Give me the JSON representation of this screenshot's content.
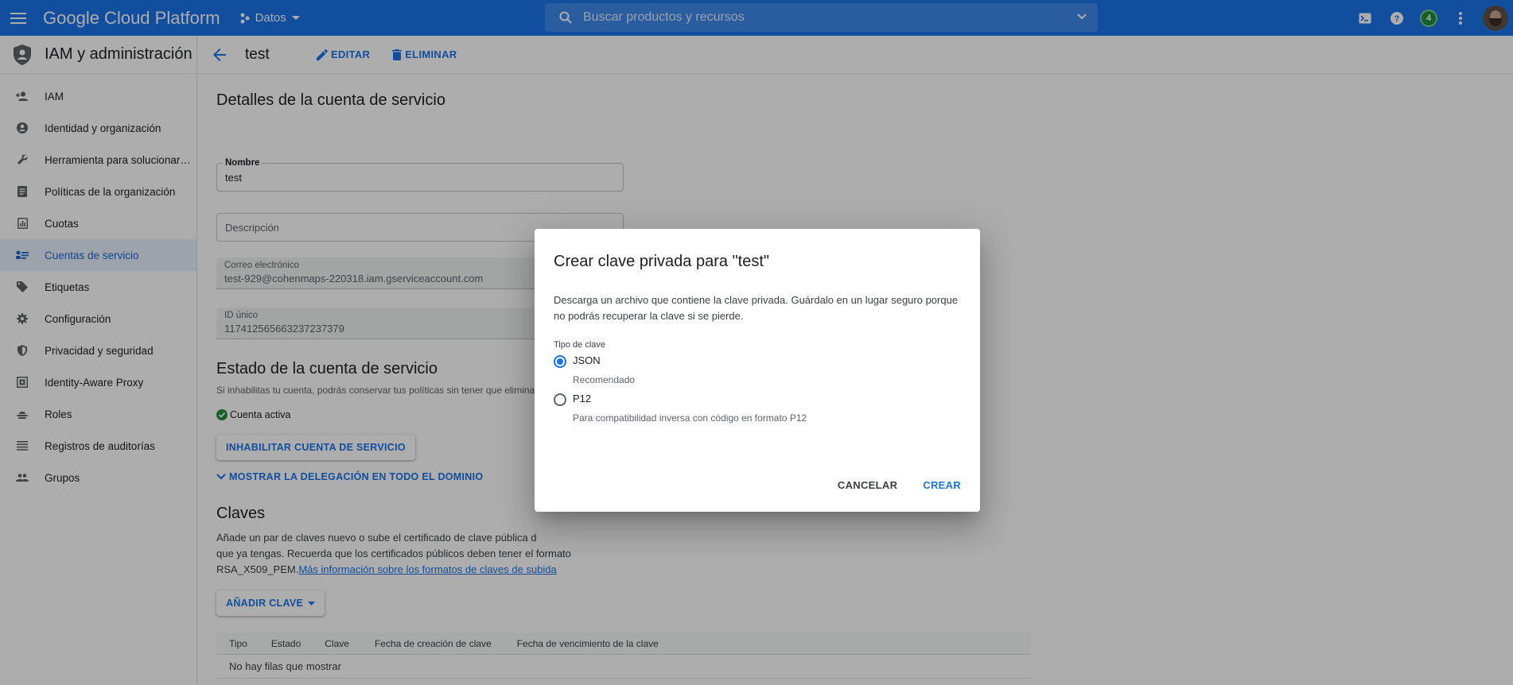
{
  "topbar": {
    "logo": "Google Cloud Platform",
    "project": "Datos",
    "search_placeholder": "Buscar productos y recursos",
    "notification_count": "4"
  },
  "sidebar": {
    "title": "IAM y administración",
    "items": [
      {
        "label": "IAM",
        "icon": "person-add-icon"
      },
      {
        "label": "Identidad y organización",
        "icon": "account-circle-icon"
      },
      {
        "label": "Herramienta para solucionar…",
        "icon": "wrench-icon"
      },
      {
        "label": "Políticas de la organización",
        "icon": "policy-doc-icon"
      },
      {
        "label": "Cuotas",
        "icon": "quota-icon"
      },
      {
        "label": "Cuentas de servicio",
        "icon": "service-account-icon",
        "active": true
      },
      {
        "label": "Etiquetas",
        "icon": "label-icon"
      },
      {
        "label": "Configuración",
        "icon": "gear-icon"
      },
      {
        "label": "Privacidad y seguridad",
        "icon": "shield-icon"
      },
      {
        "label": "Identity-Aware Proxy",
        "icon": "proxy-icon"
      },
      {
        "label": "Roles",
        "icon": "roles-icon"
      },
      {
        "label": "Registros de auditorías",
        "icon": "list-icon"
      },
      {
        "label": "Grupos",
        "icon": "groups-icon"
      }
    ]
  },
  "actionbar": {
    "title": "test",
    "edit": "EDITAR",
    "delete": "ELIMINAR"
  },
  "details": {
    "heading": "Detalles de la cuenta de servicio",
    "name_label": "Nombre",
    "name_value": "test",
    "description_placeholder": "Descripción",
    "email_label": "Correo electrónico",
    "email_value": "test-929@cohenmaps-220318.iam.gserviceaccount.com",
    "id_label": "ID único",
    "id_value": "117412565663237237379"
  },
  "status": {
    "heading": "Estado de la cuenta de servicio",
    "description": "Si inhabilitas tu cuenta, podrás conservar tus políticas sin tener que elimina",
    "active_label": "Cuenta activa",
    "disable_button": "INHABILITAR CUENTA DE SERVICIO",
    "delegation_link": "MOSTRAR LA DELEGACIÓN EN TODO EL DOMINIO"
  },
  "keys": {
    "heading": "Claves",
    "desc_line1": "Añade un par de claves nuevo o sube el certificado de clave pública d",
    "desc_line2": "que ya tengas. Recuerda que los certificados públicos deben tener el formato",
    "desc_line3_prefix": "RSA_X509_PEM.",
    "desc_link": "Más información sobre los formatos de claves de subida",
    "add_key_button": "AÑADIR CLAVE",
    "columns": [
      "Tipo",
      "Estado",
      "Clave",
      "Fecha de creación de clave",
      "Fecha de vencimiento de la clave"
    ],
    "empty": "No hay filas que mostrar"
  },
  "dialog": {
    "title": "Crear clave privada para \"test\"",
    "body": "Descarga un archivo que contiene la clave privada. Guárdalo en un lugar seguro porque no podrás recuperar la clave si se pierde.",
    "key_type_label": "Tipo de clave",
    "options": [
      {
        "label": "JSON",
        "desc": "Recomendado",
        "selected": true
      },
      {
        "label": "P12",
        "desc": "Para compatibilidad inversa con código en formato P12",
        "selected": false
      }
    ],
    "cancel": "CANCELAR",
    "create": "CREAR"
  },
  "colors": {
    "brand": "#1a73e8",
    "active_bg": "#e8f0fe",
    "success": "#1e8e3e"
  }
}
